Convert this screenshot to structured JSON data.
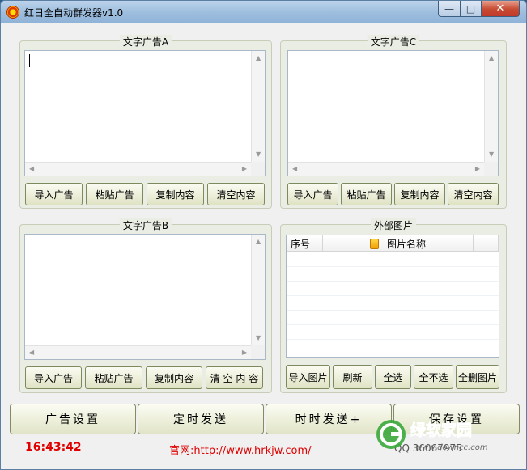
{
  "window": {
    "title": "红日全自动群发器v1.0",
    "controls": {
      "minimize": "—",
      "maximize": "□",
      "close": "✕"
    }
  },
  "groups": {
    "ad_a": {
      "legend": "文字广告A",
      "buttons": [
        "导入广告",
        "粘贴广告",
        "复制内容",
        "清空内容"
      ]
    },
    "ad_c": {
      "legend": "文字广告C",
      "buttons": [
        "导入广告",
        "粘贴广告",
        "复制内容",
        "清空内容"
      ]
    },
    "ad_b": {
      "legend": "文字广告B",
      "buttons": [
        "导入广告",
        "粘贴广告",
        "复制内容",
        "清 空 内 容"
      ]
    },
    "images": {
      "legend": "外部图片",
      "columns": [
        "序号",
        "图片名称"
      ],
      "buttons": [
        "导入图片",
        "刷新",
        "全选",
        "全不选",
        "全删图片"
      ]
    }
  },
  "bottom_buttons": [
    "广告设置",
    "定时发送",
    "时时发送+",
    "保存设置"
  ],
  "status": {
    "clock": "16:43:42",
    "website": "官网:http://www.hrkjw.com/",
    "qq": "QQ 36067975"
  },
  "watermark": {
    "brand": "绿软家园",
    "url": "www.downcc.com",
    "color": "#2e9e2e"
  }
}
